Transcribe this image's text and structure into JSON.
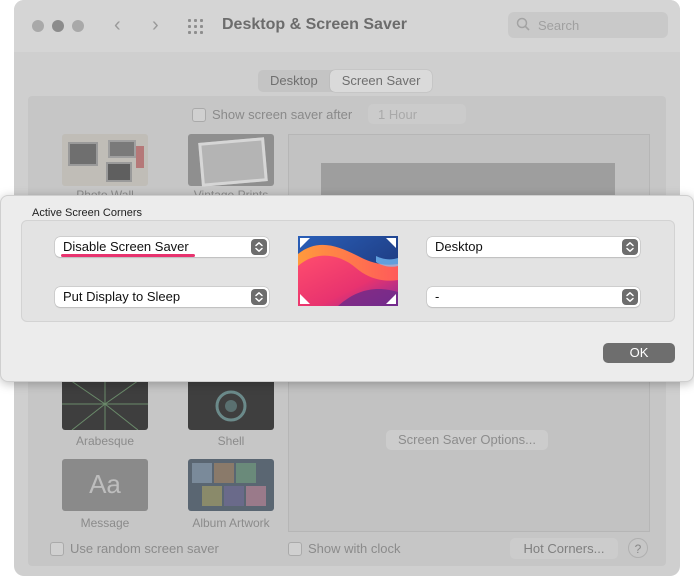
{
  "window": {
    "title": "Desktop & Screen Saver",
    "search_placeholder": "Search"
  },
  "tabs": [
    {
      "label": "Desktop",
      "selected": false
    },
    {
      "label": "Screen Saver",
      "selected": true
    }
  ],
  "screen_saver": {
    "show_after_label": "Show screen saver after",
    "show_after_value": "1 Hour",
    "thumbnails": [
      {
        "label": "Photo Wall"
      },
      {
        "label": "Vintage Prints"
      },
      {
        "label": "Arabesque"
      },
      {
        "label": "Shell"
      },
      {
        "label": "Message"
      },
      {
        "label": "Album Artwork"
      }
    ],
    "message_thumb_text": "Aa",
    "options_button": "Screen Saver Options...",
    "random_label": "Use random screen saver",
    "clock_label": "Show with clock",
    "hot_corners_button": "Hot Corners...",
    "help_label": "?"
  },
  "sheet": {
    "title": "Active Screen Corners",
    "top_left": "Disable Screen Saver",
    "bottom_left": "Put Display to Sleep",
    "top_right": "Desktop",
    "bottom_right": "-",
    "ok_button": "OK"
  },
  "colors": {
    "accent_underline": "#e8336f",
    "ok_button": "#6e6e6e"
  }
}
